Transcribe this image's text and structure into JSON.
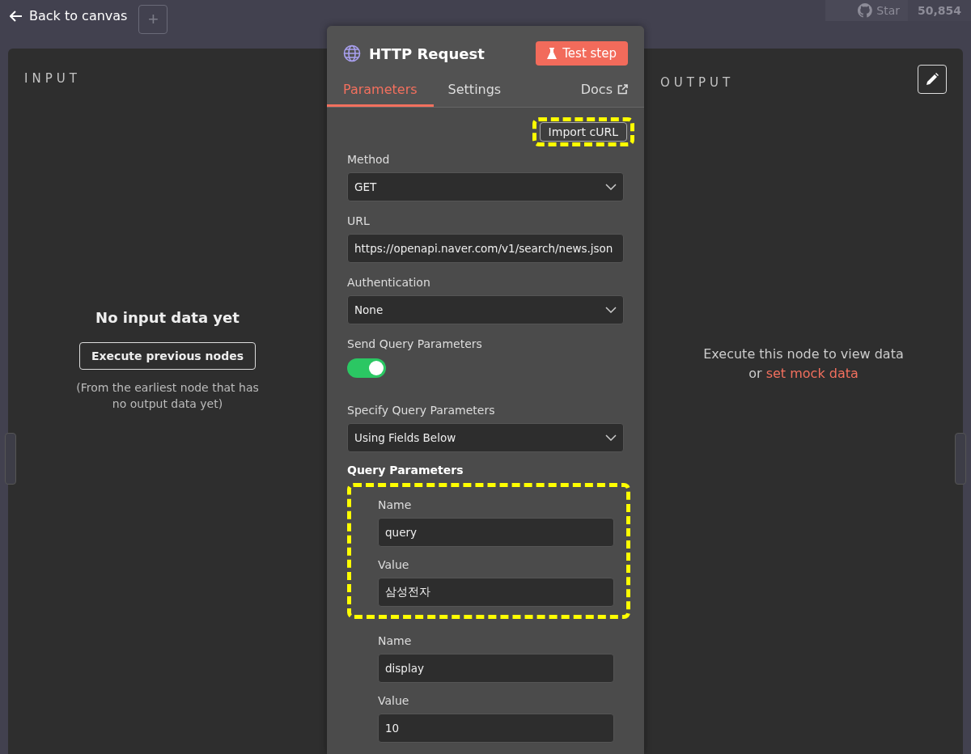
{
  "top_bar": {
    "back_label": "Back to canvas",
    "add_label": "+",
    "star_label": "Star",
    "star_count": "50,854"
  },
  "input_panel": {
    "title": "INPUT",
    "empty_title": "No input data yet",
    "button": "Execute previous nodes",
    "hint": "(From the earliest node that has no output data yet)"
  },
  "node_panel": {
    "title": "HTTP Request",
    "test_button": "Test step",
    "tabs": [
      {
        "label": "Parameters",
        "selected": true,
        "kind": "tab"
      },
      {
        "label": "Settings",
        "selected": false,
        "kind": "tab"
      },
      {
        "label": "Docs",
        "selected": false,
        "kind": "link"
      }
    ],
    "import_button": {
      "label": "Import cURL",
      "highlighted": true
    },
    "fields": [
      {
        "label": "Method",
        "kind": "select",
        "value": "GET"
      },
      {
        "label": "URL",
        "kind": "text",
        "value": "https://openapi.naver.com/v1/search/news.json"
      },
      {
        "label": "Authentication",
        "kind": "select",
        "value": "None"
      },
      {
        "label": "Send Query Parameters",
        "kind": "toggle",
        "on": true
      },
      {
        "label": "Specify Query Parameters",
        "kind": "select",
        "value": "Using Fields Below"
      }
    ],
    "query_title": "Query Parameters",
    "query_parameters": [
      {
        "highlighted": true,
        "name_label": "Name",
        "name": "query",
        "value_label": "Value",
        "value": "삼성전자"
      },
      {
        "highlighted": false,
        "name_label": "Name",
        "name": "display",
        "value_label": "Value",
        "value": "10"
      }
    ]
  },
  "output_panel": {
    "title": "OUTPUT",
    "message": "Execute this node to view data",
    "prefix": "or",
    "link": "set mock data"
  }
}
